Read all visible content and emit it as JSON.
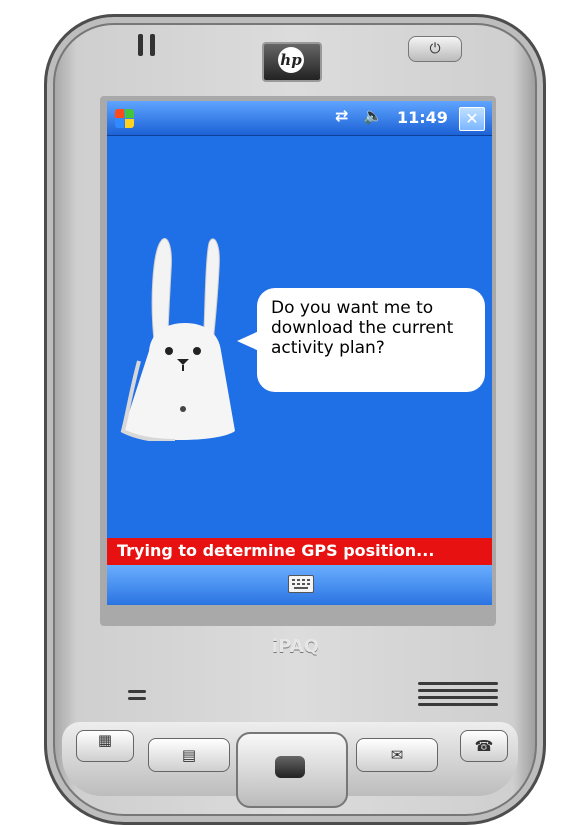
{
  "device": {
    "logo_text": "hp",
    "brand_text": "iPAQ",
    "power_symbol": "⏻"
  },
  "taskbar": {
    "start_icon": "windows-flag-icon",
    "connectivity_icon": "connectivity-arrows-icon",
    "volume_icon": "speaker-icon",
    "time": "11:49",
    "close_label": "✕",
    "colors": {
      "bar": "#1c62d6",
      "close": "#7bb6ff"
    }
  },
  "content": {
    "background": "#1f6fe6",
    "speech": "Do you want me to download the current activity plan?",
    "character_icon": "rabbit-icon"
  },
  "status": {
    "text": "Trying to determine GPS position...",
    "color": "#e81111"
  },
  "menu": {
    "keyboard_icon": "keyboard-icon"
  },
  "hardware_buttons": {
    "calendar_icon": "calendar-icon",
    "contacts_icon": "contacts-icon",
    "mail_icon": "mail-icon",
    "phone_icon": "phone-icon",
    "dpad_icon": "navigation-pad-icon"
  }
}
